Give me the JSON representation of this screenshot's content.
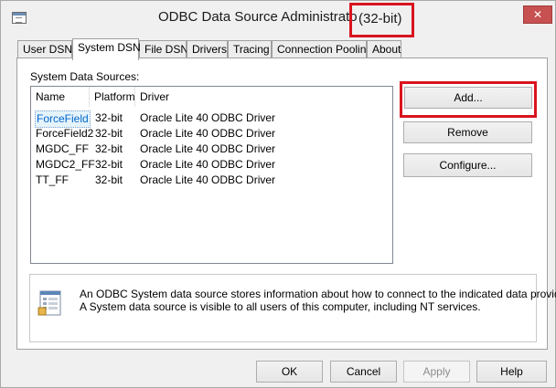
{
  "window": {
    "title": "ODBC Data Source Administrato",
    "title_suffix": "(32-bit)",
    "close_glyph": "✕"
  },
  "tabs": [
    {
      "label": "User DSN",
      "active": false
    },
    {
      "label": "System DSN",
      "active": true
    },
    {
      "label": "File DSN",
      "active": false
    },
    {
      "label": "Drivers",
      "active": false
    },
    {
      "label": "Tracing",
      "active": false
    },
    {
      "label": "Connection Pooling",
      "active": false
    },
    {
      "label": "About",
      "active": false
    }
  ],
  "system_dsn": {
    "group_label": "System Data Sources:",
    "columns": {
      "name": "Name",
      "platform": "Platform",
      "driver": "Driver"
    },
    "rows": [
      {
        "name": "ForceField",
        "platform": "32-bit",
        "driver": "Oracle Lite 40 ODBC Driver"
      },
      {
        "name": "ForceField2",
        "platform": "32-bit",
        "driver": "Oracle Lite 40 ODBC Driver"
      },
      {
        "name": "MGDC_FF",
        "platform": "32-bit",
        "driver": "Oracle Lite 40 ODBC Driver"
      },
      {
        "name": "MGDC2_FF",
        "platform": "32-bit",
        "driver": "Oracle Lite 40 ODBC Driver"
      },
      {
        "name": "TT_FF",
        "platform": "32-bit",
        "driver": "Oracle Lite 40 ODBC Driver"
      }
    ],
    "buttons": {
      "add": "Add...",
      "remove": "Remove",
      "configure": "Configure..."
    },
    "info_line1": "An ODBC System data source stores information about how to connect to the indicated data provider.",
    "info_line2": "A System data source is visible to all users of this computer, including NT services."
  },
  "footer": {
    "ok": "OK",
    "cancel": "Cancel",
    "apply": "Apply",
    "help": "Help"
  },
  "colors": {
    "highlight": "#d9141e",
    "selected_text": "#0066cc"
  },
  "icons": {
    "app": "odbc-admin-icon",
    "info": "data-source-icon",
    "close": "close-icon"
  }
}
